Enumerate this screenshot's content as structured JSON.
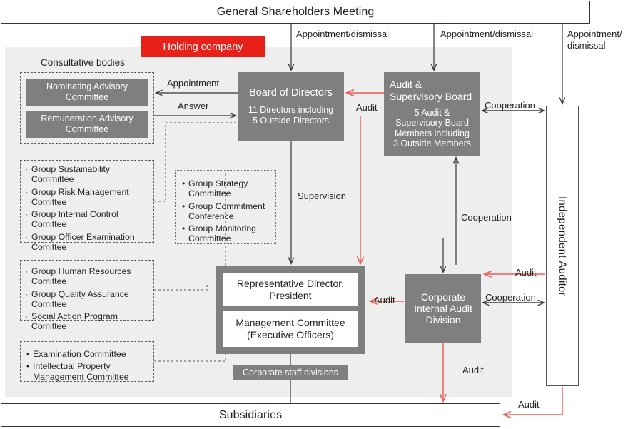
{
  "diagram": {
    "title_top": "General Shareholders Meeting",
    "title_bottom": "Subsidiaries",
    "holding_banner": "Holding company",
    "consultative_label": "Consultative bodies"
  },
  "boxes": {
    "board_of_directors": {
      "title": "Board of Directors",
      "detail": "11 Directors including\n5 Outside Directors"
    },
    "audit_supervisory_board": {
      "title": "Audit &\nSupervisory Board",
      "detail": "5 Audit &\nSupervisory Board\nMembers including\n3 Outside Members"
    },
    "corporate_internal_audit": {
      "title": "Corporate\nInternal Audit\nDivision"
    },
    "independent_auditor": {
      "title": "Independent Auditor"
    },
    "representative_director": {
      "title": "Representative Director,\nPresident"
    },
    "management_committee": {
      "title": "Management Committee\n(Executive Officers)"
    },
    "corporate_staff_divisions": {
      "title": "Corporate staff divisions"
    },
    "nominating_advisory_committee": {
      "title": "Nominating Advisory\nCommittee"
    },
    "remuneration_advisory_committee": {
      "title": "Remuneration Advisory\nCommittee"
    }
  },
  "committee_lists": {
    "group_governance": {
      "bullet": "·",
      "items": [
        "Group Sustainability\nCommittee",
        "Group Risk Management\nComittee",
        "Group Internal Control\nComittee",
        "Group Officer Examination\nComittee"
      ]
    },
    "group_operations": {
      "bullet": "·",
      "items": [
        "Group Human Resources\nComittee",
        "Group Quality Assurance\nComittee",
        "Social Action Program\nComittee"
      ]
    },
    "other_committees": {
      "bullet": "•",
      "items": [
        "Examination Committee",
        "Intellectual Property\nManagement Committee"
      ]
    },
    "group_strategy": {
      "bullet": "•",
      "items": [
        "Group Strategy\nCommittee",
        "Group Commitment\nConference",
        "Group Monitoring\nCommittee"
      ]
    }
  },
  "edge_labels": {
    "appointment_dismissal_1": "Appointment/dismissal",
    "appointment_dismissal_2": "Appointment/dismissal",
    "appointment_dismissal_3": "Appointment/\ndismissal",
    "appointment": "Appointment",
    "answer": "Answer",
    "supervision": "Supervision",
    "audit_bod": "Audit",
    "audit_ciad_left": "Audit",
    "audit_indaud_ciad": "Audit",
    "audit_ciad_subs": "Audit",
    "audit_indaud_subs": "Audit",
    "cooperation_top": "Cooperation",
    "cooperation_mid": "Cooperation",
    "cooperation_ciad": "Cooperation"
  },
  "colors": {
    "accent_red": "#e8201a",
    "arrow_red": "#ee5a52",
    "gray_box": "#7f7f7f",
    "region_gray": "#eeeeee",
    "line_dark": "#3a3330"
  }
}
